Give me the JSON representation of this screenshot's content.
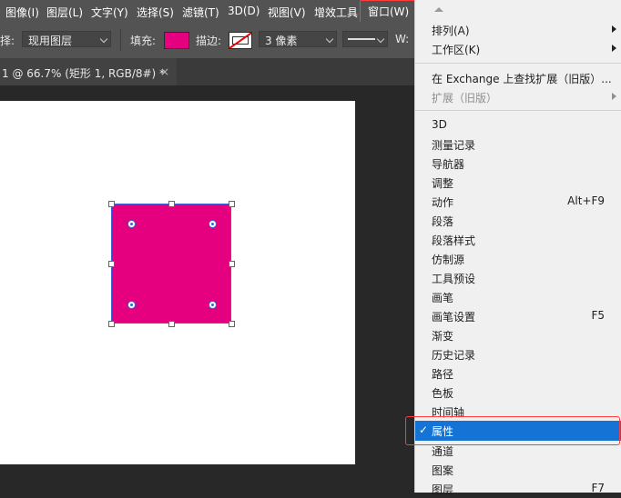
{
  "menubar": {
    "items": [
      "图像(I)",
      "图层(L)",
      "文字(Y)",
      "选择(S)",
      "滤镜(T)",
      "3D(D)",
      "视图(V)",
      "增效工具",
      "窗口(W)"
    ]
  },
  "options_bar": {
    "select_label": "择:",
    "select_value": "现用图层",
    "fill_label": "填充:",
    "stroke_label": "描边:",
    "stroke_width": "3 像素",
    "width_label": "W:",
    "fill_color": "#e4007e"
  },
  "document_tab": {
    "title": "1 @ 66.7% (矩形 1, RGB/8#) *",
    "close": "×"
  },
  "window_menu": {
    "arrange": "排列(A)",
    "workspace": "工作区(K)",
    "find_extensions": "在 Exchange 上查找扩展（旧版）...",
    "extensions": "扩展（旧版）",
    "panels": [
      {
        "label": "3D",
        "shortcut": ""
      },
      {
        "label": "测量记录",
        "shortcut": ""
      },
      {
        "label": "导航器",
        "shortcut": ""
      },
      {
        "label": "调整",
        "shortcut": ""
      },
      {
        "label": "动作",
        "shortcut": "Alt+F9"
      },
      {
        "label": "段落",
        "shortcut": ""
      },
      {
        "label": "段落样式",
        "shortcut": ""
      },
      {
        "label": "仿制源",
        "shortcut": ""
      },
      {
        "label": "工具预设",
        "shortcut": ""
      },
      {
        "label": "画笔",
        "shortcut": ""
      },
      {
        "label": "画笔设置",
        "shortcut": "F5"
      },
      {
        "label": "渐变",
        "shortcut": ""
      },
      {
        "label": "历史记录",
        "shortcut": ""
      },
      {
        "label": "路径",
        "shortcut": ""
      },
      {
        "label": "色板",
        "shortcut": ""
      },
      {
        "label": "时间轴",
        "shortcut": ""
      },
      {
        "label": "属性",
        "shortcut": "",
        "checked": true
      },
      {
        "label": "通道",
        "shortcut": ""
      },
      {
        "label": "图案",
        "shortcut": ""
      },
      {
        "label": "图层",
        "shortcut": "F7"
      }
    ],
    "check_mark": "✓"
  },
  "colors": {
    "shape_fill": "#e4007e",
    "highlight": "#1473d4",
    "callout": "#ff3b3b"
  }
}
